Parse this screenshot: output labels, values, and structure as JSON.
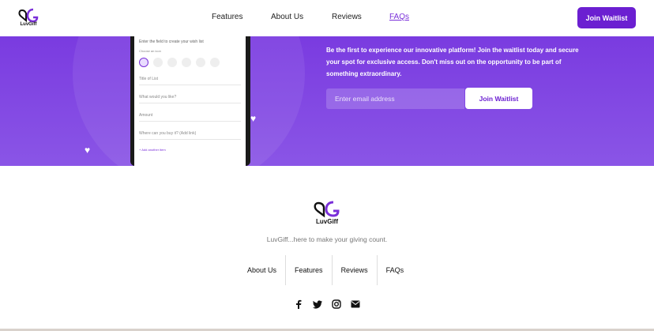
{
  "brand": {
    "name": "LuvGiff",
    "tagline": "LuvGiff...here to make your giving count."
  },
  "nav": {
    "items": [
      "Features",
      "About Us",
      "Reviews",
      "FAQs"
    ],
    "active": "FAQs",
    "join_label": "Join Waitlist"
  },
  "hero": {
    "description": "Be the first to experience our innovative platform! Join the waitlist today and secure your spot for exclusive access. Don't miss out on the opportunity to be part of something extraordinary.",
    "email_placeholder": "Enter email address",
    "join_label": "Join Waitlist"
  },
  "phone_form": {
    "header": "Enter the field to create your wish list",
    "choose_icon": "Choose an icon",
    "fields": [
      "Title of List",
      "What would you like?",
      "Amount",
      "Where can you buy it? (Add link)"
    ],
    "add_item": "Add another item"
  },
  "footer": {
    "links": [
      "About Us",
      "Features",
      "Reviews",
      "FAQs"
    ],
    "social": [
      "facebook-icon",
      "twitter-icon",
      "instagram-icon",
      "mail-icon"
    ]
  },
  "colors": {
    "accent": "#6b1fd1",
    "hero_bg": "#7a3be0"
  }
}
